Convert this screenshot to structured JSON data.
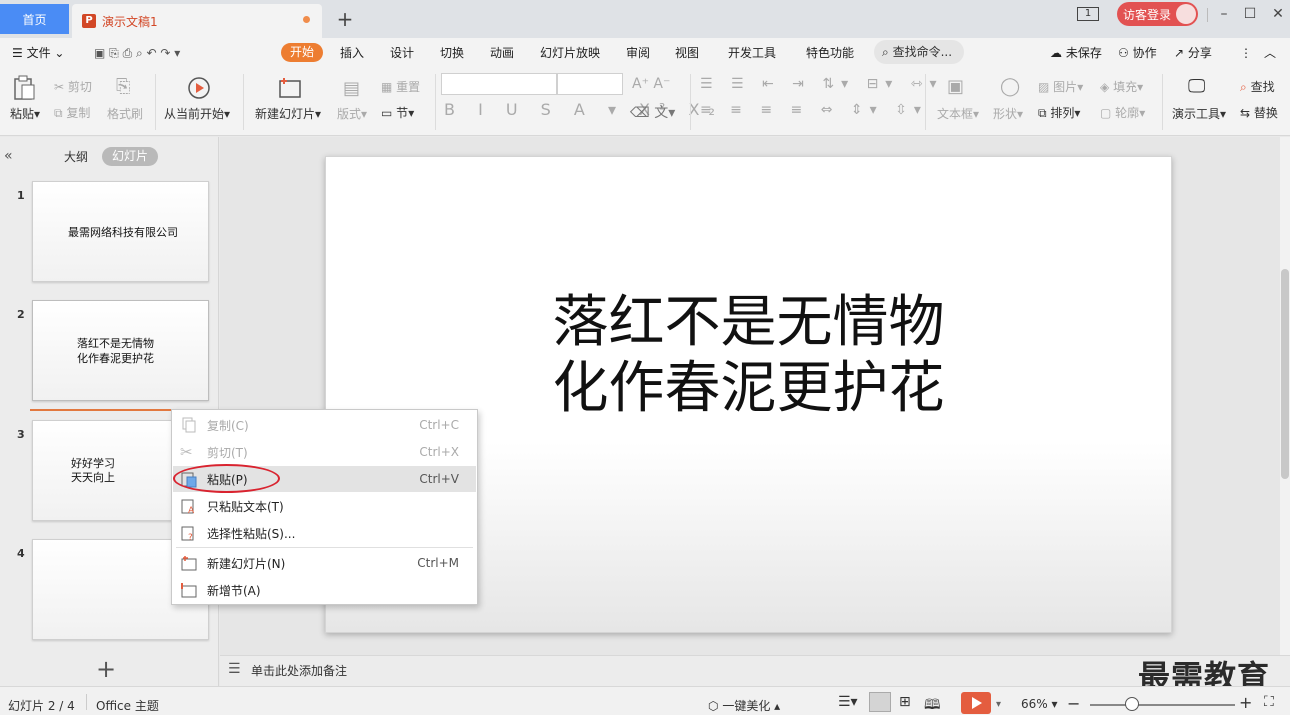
{
  "tabs": {
    "home": "首页",
    "document": "演示文稿1"
  },
  "titlebar": {
    "window_num": "1",
    "login": "访客登录"
  },
  "menu": {
    "file": "文件",
    "items": [
      "开始",
      "插入",
      "设计",
      "切换",
      "动画",
      "幻灯片放映",
      "审阅",
      "视图",
      "开发工具",
      "特色功能"
    ],
    "search": "查找命令...",
    "unsaved": "未保存",
    "collab": "协作",
    "share": "分享"
  },
  "ribbon": {
    "paste": "粘贴",
    "cut": "剪切",
    "copy": "复制",
    "format_painter": "格式刷",
    "from_current": "从当前开始",
    "new_slide": "新建幻灯片",
    "layout": "版式",
    "reset": "重置",
    "section": "节",
    "textbox": "文本框",
    "shape": "形状",
    "picture": "图片",
    "arrange": "排列",
    "fill": "填充",
    "outline": "轮廓",
    "present_tools": "演示工具",
    "find": "查找",
    "replace": "替换"
  },
  "panel": {
    "outline_tab": "大纲",
    "slides_tab": "幻灯片",
    "slides": [
      {
        "num": "1",
        "lines": [
          "最需网络科技有限公司"
        ]
      },
      {
        "num": "2",
        "lines": [
          "落红不是无情物",
          "化作春泥更护花"
        ]
      },
      {
        "num": "3",
        "lines": [
          "好好学习",
          "天天向上"
        ]
      },
      {
        "num": "4",
        "lines": []
      }
    ]
  },
  "slide": {
    "line1": "落红不是无情物",
    "line2": "化作春泥更护花"
  },
  "notes_placeholder": "单击此处添加备注",
  "context_menu": {
    "items": [
      {
        "label": "复制(C)",
        "shortcut": "Ctrl+C",
        "enabled": false
      },
      {
        "label": "剪切(T)",
        "shortcut": "Ctrl+X",
        "enabled": false
      },
      {
        "label": "粘贴(P)",
        "shortcut": "Ctrl+V",
        "enabled": true,
        "highlighted": true
      },
      {
        "label": "只粘贴文本(T)",
        "shortcut": "",
        "enabled": true
      },
      {
        "label": "选择性粘贴(S)...",
        "shortcut": "",
        "enabled": true
      },
      {
        "label": "新建幻灯片(N)",
        "shortcut": "Ctrl+M",
        "enabled": true
      },
      {
        "label": "新增节(A)",
        "shortcut": "",
        "enabled": true
      }
    ]
  },
  "status": {
    "slide_pos": "幻灯片 2 / 4",
    "theme": "Office 主题",
    "beautify": "一键美化",
    "zoom": "66%"
  },
  "watermark": "最需教育",
  "colors": {
    "accent": "#ed7d31",
    "home_tab": "#4a8cf5",
    "play": "#e45d3f",
    "highlight_ring": "#d9232f"
  }
}
